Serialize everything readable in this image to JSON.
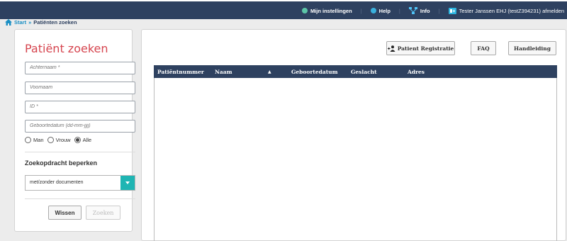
{
  "topbar": {
    "settings_label": "Mijn instellingen",
    "help_label": "Help",
    "info_label": "Info",
    "user_label": "Tester Janssen EHJ (testZ394231) afmelden",
    "separator": "|"
  },
  "breadcrumb": {
    "home": "Start",
    "separator": "»",
    "current": "Patiënten zoeken"
  },
  "search": {
    "title": "Patiënt zoeken",
    "fields": {
      "lastname_placeholder": "Achternaam *",
      "firstname_placeholder": "Voornaam",
      "id_placeholder": "ID *",
      "birthdate_placeholder": "Geboortedatum (dd-mm-jjjj)"
    },
    "gender": {
      "options": [
        "Man",
        "Vrouw",
        "Alle"
      ],
      "selected": "Alle"
    },
    "restrict_title": "Zoekopdracht beperken",
    "restrict_value": "met/zonder documenten",
    "clear_label": "Wissen",
    "search_label": "Zoeken"
  },
  "toolbar": {
    "register_label": "Patient Registratie",
    "faq_label": "FAQ",
    "manual_label": "Handleiding"
  },
  "table": {
    "columns": [
      "Patiëntnummer",
      "Naam",
      "▲",
      "Geboortedatum",
      "Geslacht",
      "Adres"
    ],
    "rows": []
  },
  "colors": {
    "header_navy": "#2e4160",
    "title_red": "#d6454f",
    "accent_teal": "#1fb5b3",
    "link_blue": "#1a8fc4"
  }
}
